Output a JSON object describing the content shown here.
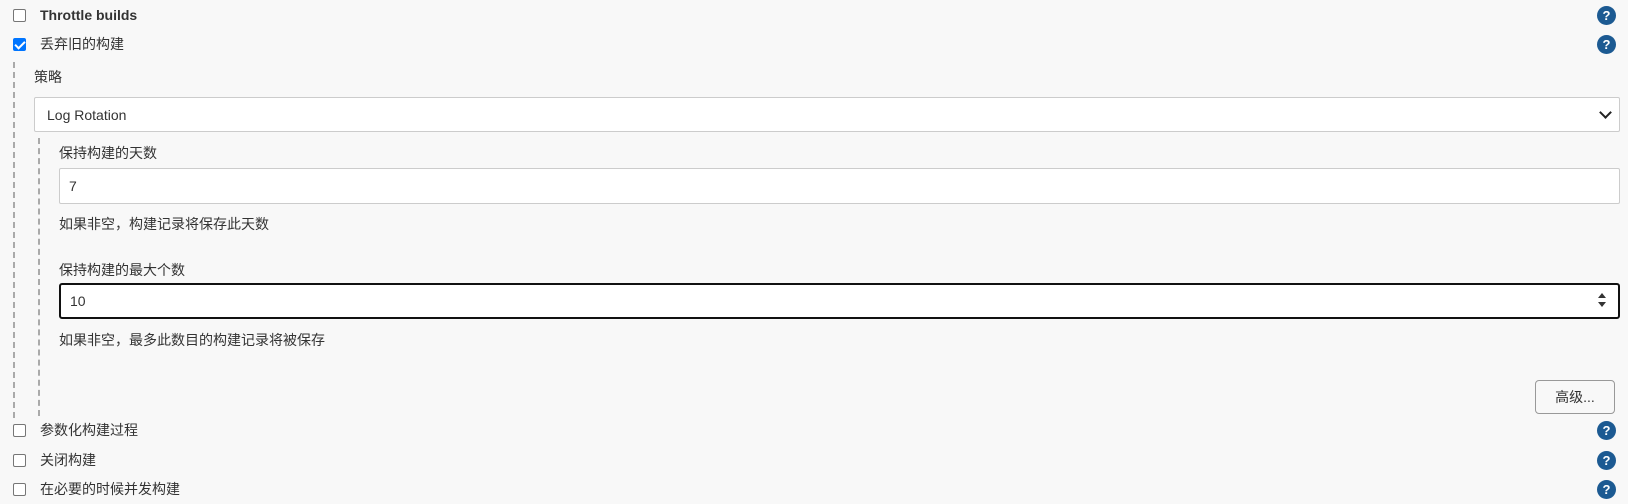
{
  "options": {
    "throttle_builds": {
      "label": "Throttle builds",
      "checked": false
    },
    "discard_old_builds": {
      "label": "丢弃旧的构建",
      "checked": true
    },
    "parameterized": {
      "label": "参数化构建过程",
      "checked": false
    },
    "disable_build": {
      "label": "关闭构建",
      "checked": false
    },
    "concurrent_builds": {
      "label": "在必要的时候并发构建",
      "checked": false
    }
  },
  "help_glyph": "?",
  "strategy": {
    "label": "策略",
    "selected": "Log Rotation"
  },
  "days_to_keep": {
    "label": "保持构建的天数",
    "value": "7",
    "hint": "如果非空，构建记录将保存此天数"
  },
  "max_builds": {
    "label": "保持构建的最大个数",
    "value": "10",
    "hint": "如果非空，最多此数目的构建记录将被保存"
  },
  "advanced_button": "高级...",
  "colors": {
    "checkbox_checked": "#0075ff",
    "help_icon": "#1c5a92",
    "background": "#f8f8f8"
  }
}
